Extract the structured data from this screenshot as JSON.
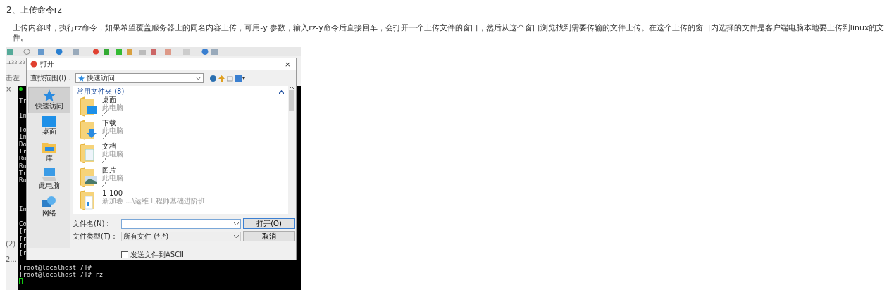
{
  "article": {
    "heading": "2、上传命令rz",
    "paragraph": "上传内容时，执行rz命令，如果希望覆盖服务器上的同名内容上传，可用-y 参数，输入rz-y命令后直接回车，会打开一个上传文件的窗口，然后从这个窗口浏览找到需要传输的文件上传。在这个上传的窗口内选择的文件是客户端电脑本地要上传到linux的文件。"
  },
  "screenshot": {
    "side_texts": [
      ".132:22",
      "击左",
      "×",
      "(2)",
      "2..."
    ],
    "terminal_lines": [
      "Tr",
      "--",
      "In",
      "To",
      "In",
      "Do",
      "lr",
      "Ru",
      "Ru",
      "Tr",
      "Ru",
      "In",
      "Co",
      "[r",
      "[r",
      "[r",
      "[r",
      "[root@localhost /]#",
      "[root@localhost /]# rz"
    ],
    "dialog": {
      "title": "打开",
      "close": "×",
      "look_in": {
        "label": "查找范围(I)：",
        "value": "快速访问"
      },
      "nav": [
        {
          "label": "快速访问",
          "kind": "star",
          "selected": true
        },
        {
          "label": "桌面",
          "kind": "desktop",
          "selected": false
        },
        {
          "label": "库",
          "kind": "library",
          "selected": false
        },
        {
          "label": "此电脑",
          "kind": "computer",
          "selected": false
        },
        {
          "label": "网络",
          "kind": "network",
          "selected": false
        }
      ],
      "group": {
        "title": "常用文件夹 (8)",
        "expanded": true
      },
      "items": [
        {
          "name": "桌面",
          "location": "此电脑",
          "pinned": true,
          "kind": "desktop"
        },
        {
          "name": "下载",
          "location": "此电脑",
          "pinned": true,
          "kind": "download"
        },
        {
          "name": "文档",
          "location": "此电脑",
          "pinned": true,
          "kind": "document"
        },
        {
          "name": "图片",
          "location": "此电脑",
          "pinned": true,
          "kind": "picture"
        },
        {
          "name": "1-100",
          "location": "新加卷 ...\\运维工程师基础进阶班",
          "pinned": false,
          "kind": "plain"
        }
      ],
      "file_name": {
        "label": "文件名(N)："
      },
      "file_type": {
        "label": "文件类型(T)：",
        "value": "所有文件 (*.*)"
      },
      "buttons": [
        "打开(O)",
        "取消"
      ],
      "ascii": {
        "label": "发送文件到ASCII",
        "checked": false
      }
    }
  }
}
